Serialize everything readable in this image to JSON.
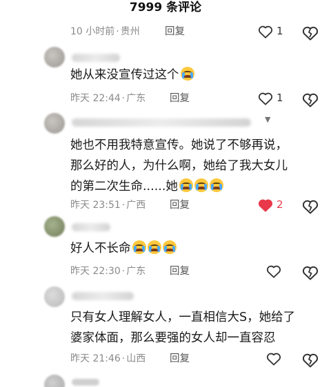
{
  "header": {
    "title": "7999 条评论"
  },
  "comments": [
    {
      "text": "",
      "time": "10 小时前",
      "location": "贵州",
      "reply": "回复",
      "likes": "1",
      "liked": false
    },
    {
      "text": "她从来没宣传过这个",
      "emoji_count": 1,
      "time": "昨天 22:44",
      "location": "广东",
      "reply": "回复",
      "likes": "1",
      "liked": false
    },
    {
      "text_lines": [
        "她也不用我特意宣传。她说了不够再说，",
        "那么好的人，为什么啊，她给了我大女儿",
        "的第二次生命......她"
      ],
      "emoji_count": 3,
      "time": "昨天 23:51",
      "location": "广西",
      "reply": "回复",
      "likes": "2",
      "liked": true
    },
    {
      "text": "好人不长命",
      "emoji_count": 3,
      "time": "昨天 22:30",
      "location": "广东",
      "reply": "回复",
      "likes": "",
      "liked": false
    },
    {
      "text_lines": [
        "只有女人理解女人，一直相信大S，她给了",
        "婆家体面，那么要强的女人却一直容忍"
      ],
      "time": "昨天 21:46",
      "location": "山西",
      "reply": "回复",
      "likes": "",
      "liked": false
    }
  ],
  "colors": {
    "liked": "#e8394a",
    "meta": "#8a8a8a",
    "icon": "#333333"
  },
  "icons": {
    "like": "heart-outline-icon",
    "liked": "heart-filled-icon",
    "dislike": "broken-heart-icon"
  }
}
